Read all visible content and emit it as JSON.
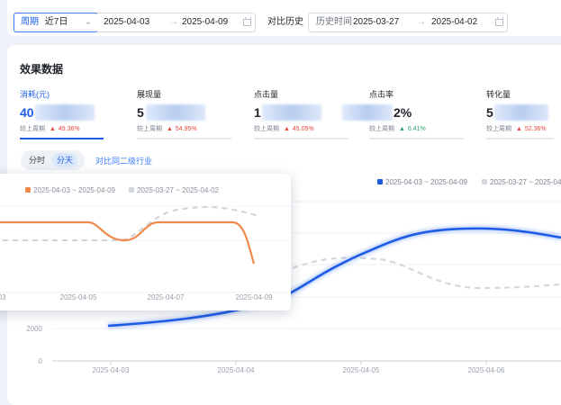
{
  "filters": {
    "period_label": "周期",
    "period_value": "近7日",
    "range_start": "2025-04-03",
    "range_end": "2025-04-09",
    "range_separator": "→",
    "compare_label": "对比历史",
    "compare_hint": "历史时间",
    "compare_start": "2025-03-27",
    "compare_end": "2025-04-02"
  },
  "section_title": "效果数据",
  "metrics": [
    {
      "label": "消耗(元)",
      "value": "40",
      "compare_text": "较上周期",
      "change": "49.36%",
      "direction": "up",
      "active": true
    },
    {
      "label": "展现量",
      "value": "5",
      "compare_text": "较上周期",
      "change": "54.95%",
      "direction": "up",
      "active": false
    },
    {
      "label": "点击量",
      "value": "1",
      "compare_text": "较上周期",
      "change": "45.05%",
      "direction": "up",
      "active": false
    },
    {
      "label": "点击率",
      "value": "2%",
      "compare_text": "较上周期",
      "change": "6.41%",
      "direction": "up",
      "active": false
    },
    {
      "label": "转化量",
      "value": "5",
      "compare_text": "较上周期",
      "change": "52.36%",
      "direction": "up",
      "active": false
    }
  ],
  "granularity": {
    "options": [
      "分时",
      "分天"
    ],
    "selected": "分天"
  },
  "industry_link": "对比同二级行业",
  "colors": {
    "primary": "#1d5de6",
    "current_series": "#1d5de6",
    "compare_series": "#d3d7de",
    "tooltip_current": "#f08a4b",
    "up": "#e8453c",
    "up_green": "#2ca46b"
  },
  "chart_data": {
    "type": "line",
    "x": [
      "2025-04-03",
      "2025-04-04",
      "2025-04-05",
      "2025-04-06"
    ],
    "y_ticks": [
      "0",
      "2000"
    ],
    "series": [
      {
        "name": "2025-04-03 ~ 2025-04-09",
        "style": "solid"
      },
      {
        "name": "2025-03-27 ~ 2025-04-02",
        "style": "dashed"
      }
    ]
  },
  "tooltip_chart": {
    "x_ticks": [
      "03",
      "2025-04-05",
      "2025-04-07",
      "2025-04-09"
    ],
    "series": [
      {
        "name": "2025-04-03 ~ 2025-04-09"
      },
      {
        "name": "2025-03-27 ~ 2025-04-02"
      }
    ]
  }
}
